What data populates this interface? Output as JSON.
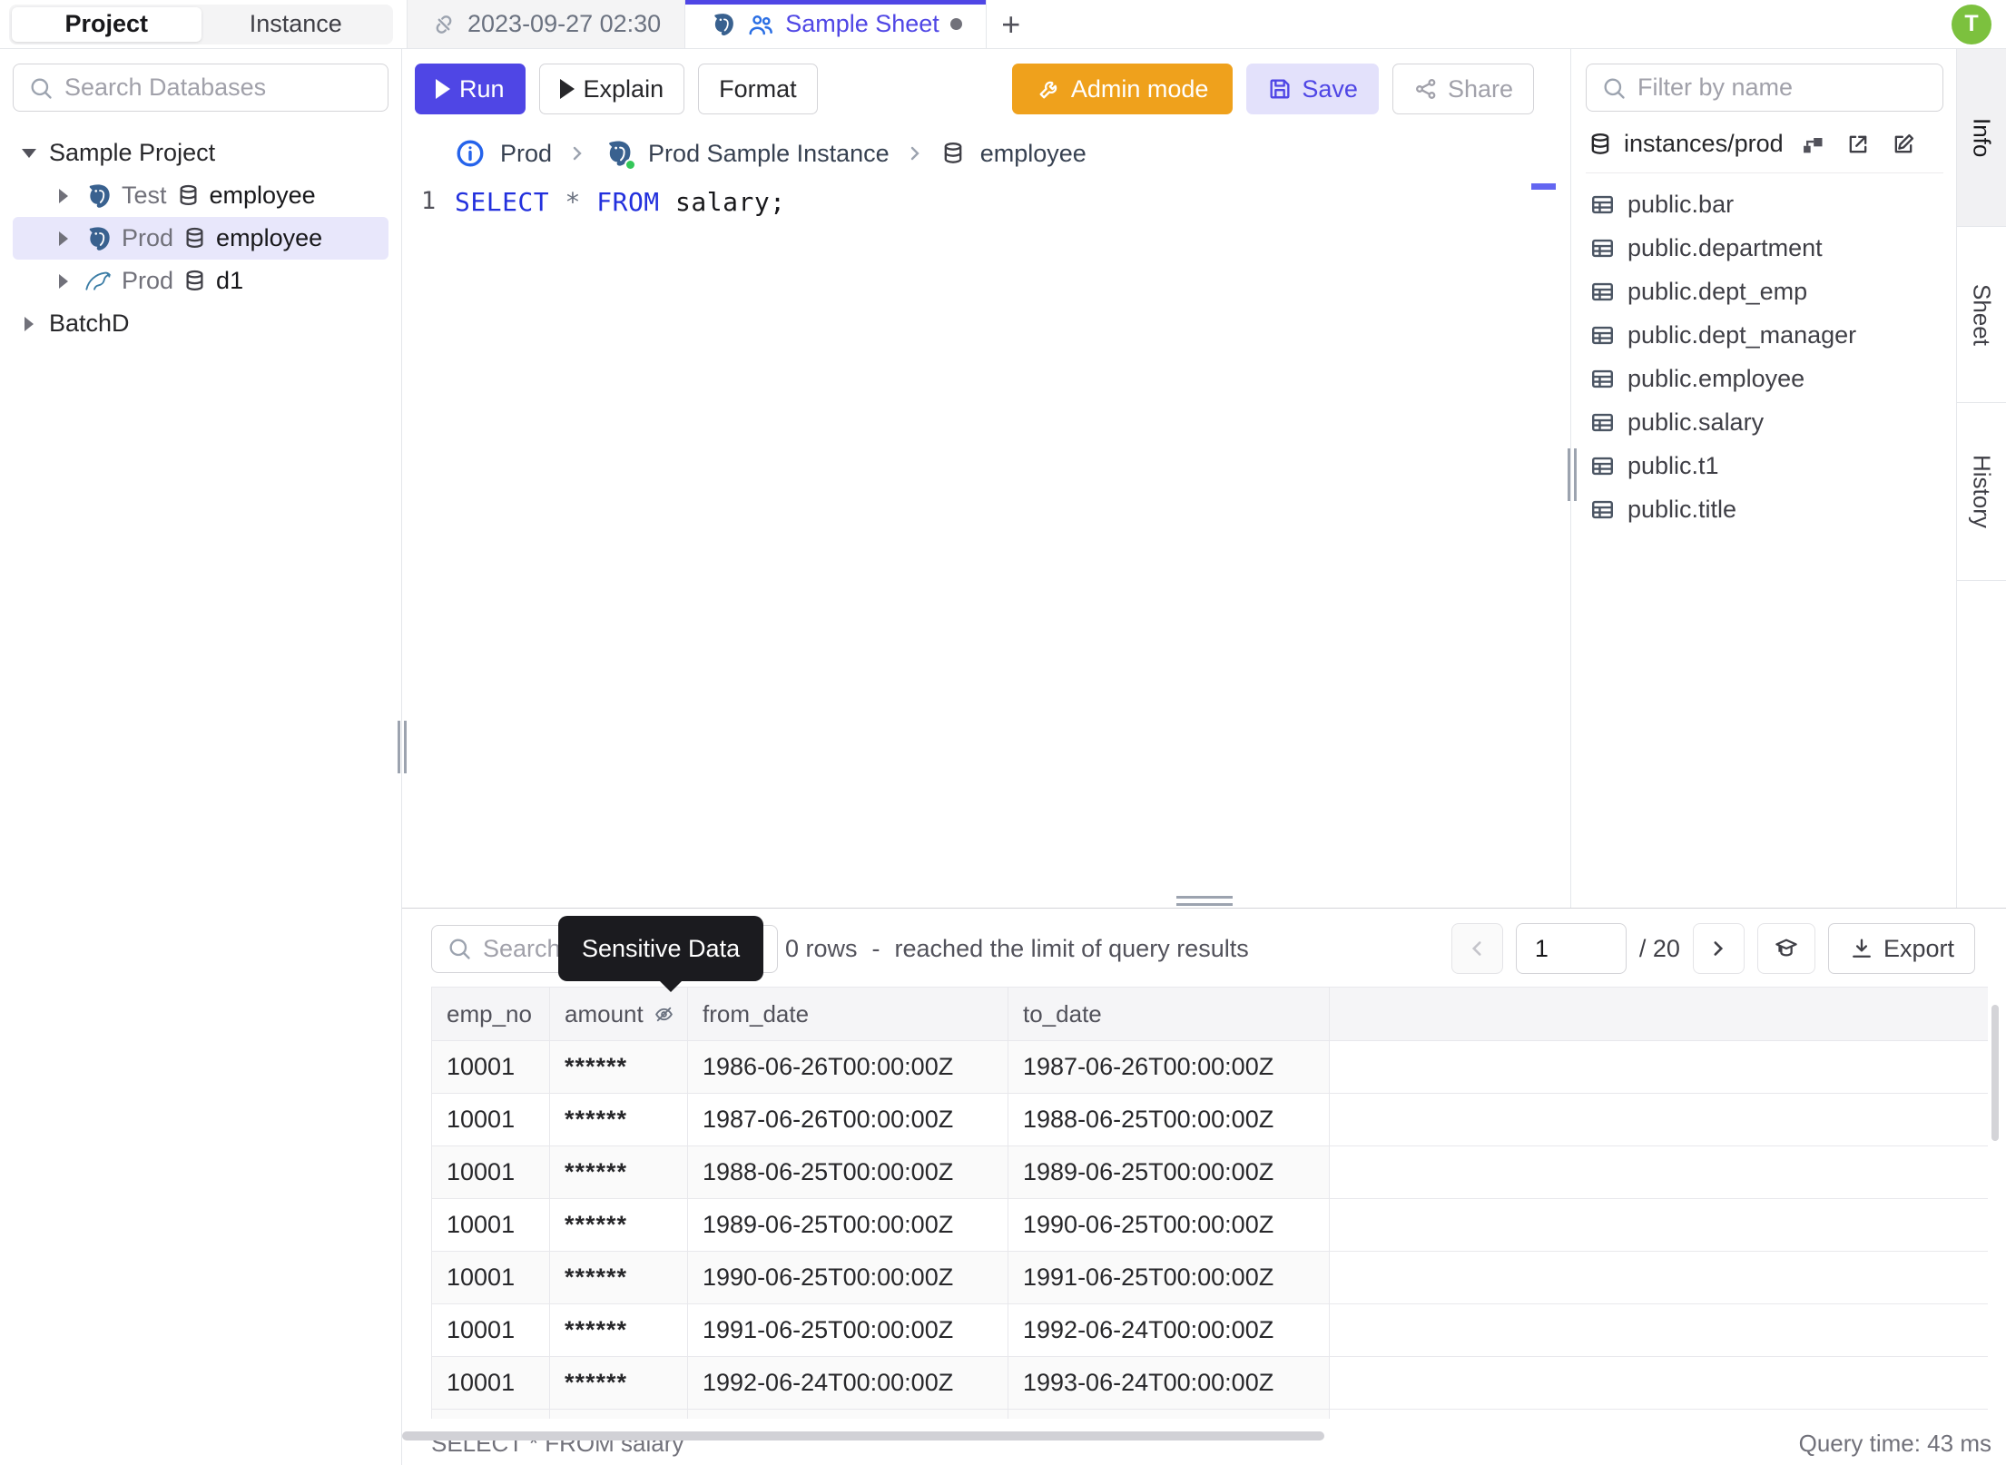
{
  "colors": {
    "accent": "#4f46e5",
    "admin_orange": "#efa11c",
    "avatar_green": "#7cc13e",
    "tooltip_bg": "#1b1b1f",
    "postgres_blue": "#39618f",
    "mysql_teal": "#3a7ca5",
    "sql_keyword_blue": "#2230dd",
    "selected_row_bg": "#e8e7fb",
    "status_dot_green": "#34c759"
  },
  "topbar": {
    "project_tab": "Project",
    "instance_tab": "Instance",
    "sheet_tab_1": "2023-09-27 02:30",
    "sheet_tab_2": "Sample Sheet",
    "new_tab_label": "+",
    "avatar_initial": "T"
  },
  "sidebar": {
    "search_placeholder": "Search Databases",
    "tree": {
      "project_label": "Sample Project",
      "items": [
        {
          "env": "Test",
          "db": "employee",
          "engine": "postgres"
        },
        {
          "env": "Prod",
          "db": "employee",
          "engine": "postgres",
          "selected": true
        },
        {
          "env": "Prod",
          "db": "d1",
          "engine": "mysql"
        }
      ],
      "batch_label": "BatchD"
    }
  },
  "toolbar": {
    "run_label": "Run",
    "explain_label": "Explain",
    "format_label": "Format",
    "admin_label": "Admin mode",
    "save_label": "Save",
    "share_label": "Share"
  },
  "breadcrumb": {
    "environment": "Prod",
    "instance": "Prod Sample Instance",
    "database": "employee"
  },
  "editor": {
    "line_number": "1",
    "keyword_select": "SELECT",
    "star": "*",
    "keyword_from": "FROM",
    "rest": "salary;"
  },
  "schema_panel": {
    "filter_placeholder": "Filter by name",
    "title": "instances/prod",
    "tables": [
      "public.bar",
      "public.department",
      "public.dept_emp",
      "public.dept_manager",
      "public.employee",
      "public.salary",
      "public.t1",
      "public.title"
    ]
  },
  "rail": {
    "tabs": [
      "Info",
      "Sheet",
      "History"
    ]
  },
  "results": {
    "search_placeholder": "Search",
    "tooltip": "Sensitive Data",
    "rows_count": "0 rows",
    "rows_sep": "-",
    "rows_limit_note": "reached the limit of query results",
    "page_value": "1",
    "page_total": "/ 20",
    "export_label": "Export",
    "columns": [
      "emp_no",
      "amount",
      "from_date",
      "to_date"
    ],
    "rows": [
      [
        "10001",
        "******",
        "1986-06-26T00:00:00Z",
        "1987-06-26T00:00:00Z"
      ],
      [
        "10001",
        "******",
        "1987-06-26T00:00:00Z",
        "1988-06-25T00:00:00Z"
      ],
      [
        "10001",
        "******",
        "1988-06-25T00:00:00Z",
        "1989-06-25T00:00:00Z"
      ],
      [
        "10001",
        "******",
        "1989-06-25T00:00:00Z",
        "1990-06-25T00:00:00Z"
      ],
      [
        "10001",
        "******",
        "1990-06-25T00:00:00Z",
        "1991-06-25T00:00:00Z"
      ],
      [
        "10001",
        "******",
        "1991-06-25T00:00:00Z",
        "1992-06-24T00:00:00Z"
      ],
      [
        "10001",
        "******",
        "1992-06-24T00:00:00Z",
        "1993-06-24T00:00:00Z"
      ]
    ],
    "footer_query": "SELECT * FROM salary",
    "query_time": "Query time: 43 ms"
  }
}
